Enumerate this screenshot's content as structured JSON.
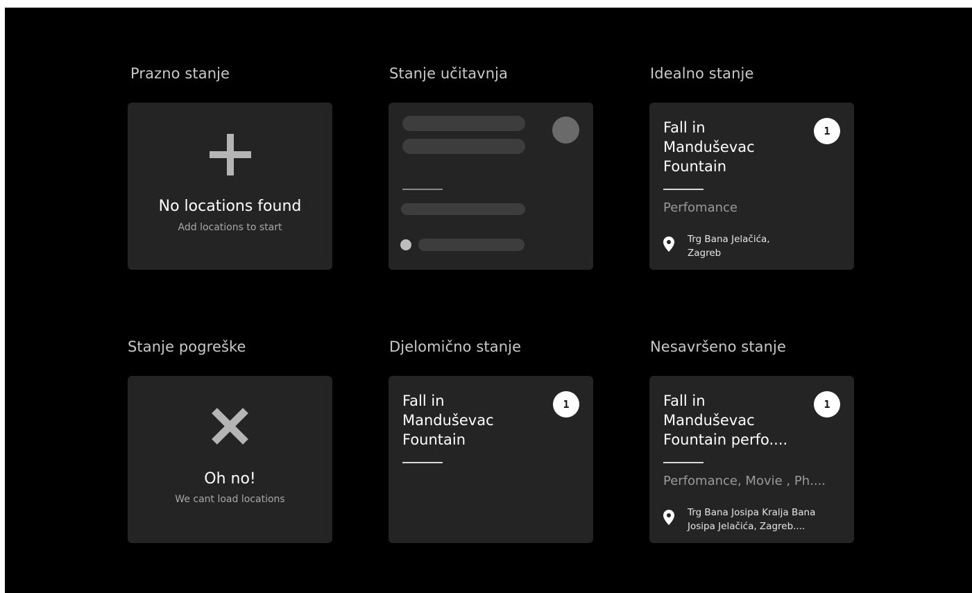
{
  "sections": {
    "empty": {
      "title": "Prazno stanje",
      "heading": "No locations found",
      "subheading": "Add locations to start",
      "icon": "plus-icon"
    },
    "loading": {
      "title": "Stanje učitavnja"
    },
    "ideal": {
      "title": "Idealno stanje",
      "location_title": "Fall in\nManduševac\nFountain",
      "badge": "1",
      "category": "Perfomance",
      "address": "Trg Bana Jelačića,\nZagreb",
      "icon": "location-pin-icon"
    },
    "error": {
      "title": "Stanje pogreške",
      "heading": "Oh no!",
      "subheading": "We cant load locations",
      "icon": "close-icon"
    },
    "partial": {
      "title": "Djelomično stanje",
      "location_title": "Fall in\nManduševac\nFountain",
      "badge": "1"
    },
    "imperfect": {
      "title": "Nesavršeno stanje",
      "location_title": "Fall in\nManduševac\nFountain perfo....",
      "badge": "1",
      "category": "Perfomance, Movie , Ph....",
      "address": "Trg Bana Josipa Kralja Bana\nJosipa Jelačića, Zagreb....",
      "icon": "location-pin-icon"
    }
  },
  "colors": {
    "background": "#000000",
    "card": "#242424",
    "skeleton": "#3d3d3d",
    "icon_gray": "#b5b5b5"
  }
}
